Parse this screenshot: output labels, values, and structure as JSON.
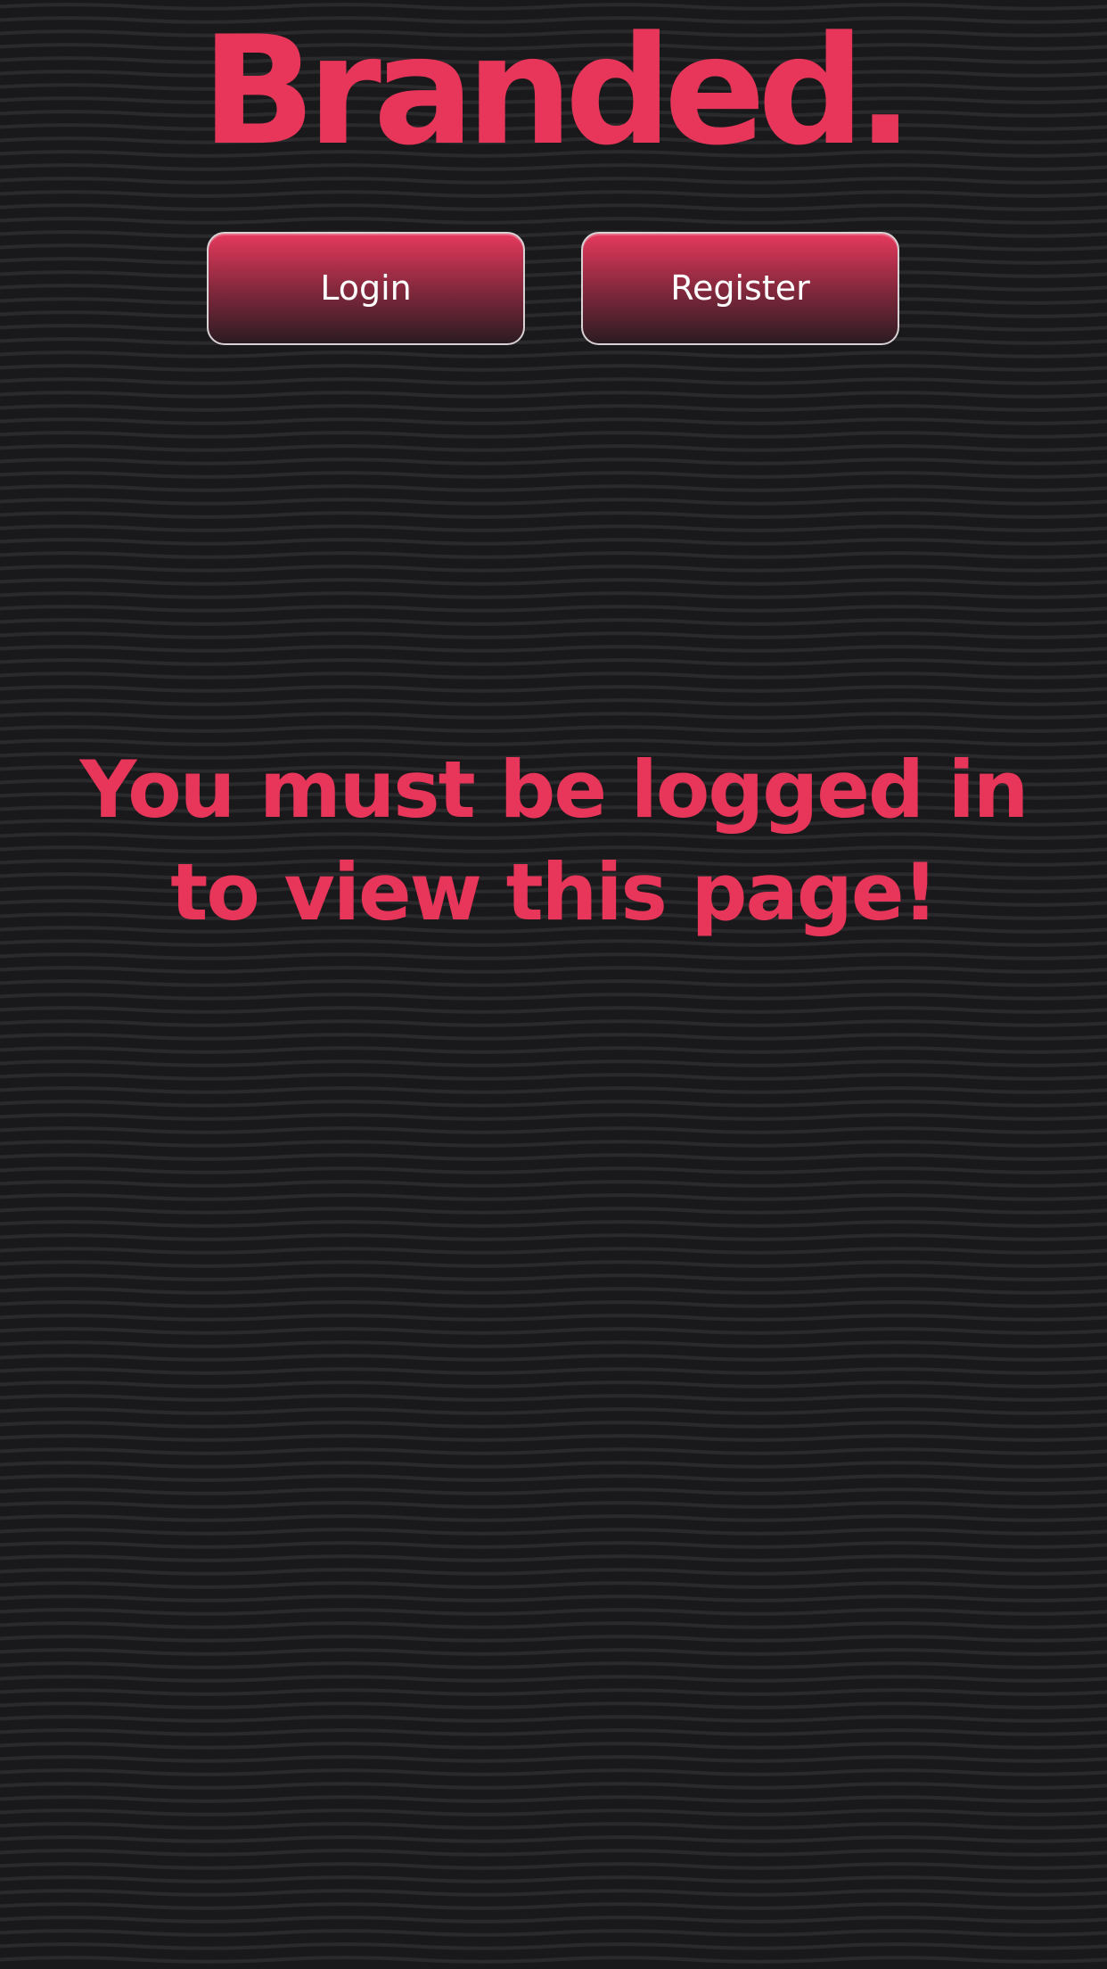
{
  "brand": {
    "logo_text": "Branded."
  },
  "auth": {
    "login_label": "Login",
    "register_label": "Register"
  },
  "main": {
    "message": "You must be logged in to view this page!"
  },
  "colors": {
    "accent": "#e8365a",
    "background": "#19181a",
    "button_gradient_top": "#e6395d",
    "button_gradient_bottom": "#2b1b22"
  }
}
